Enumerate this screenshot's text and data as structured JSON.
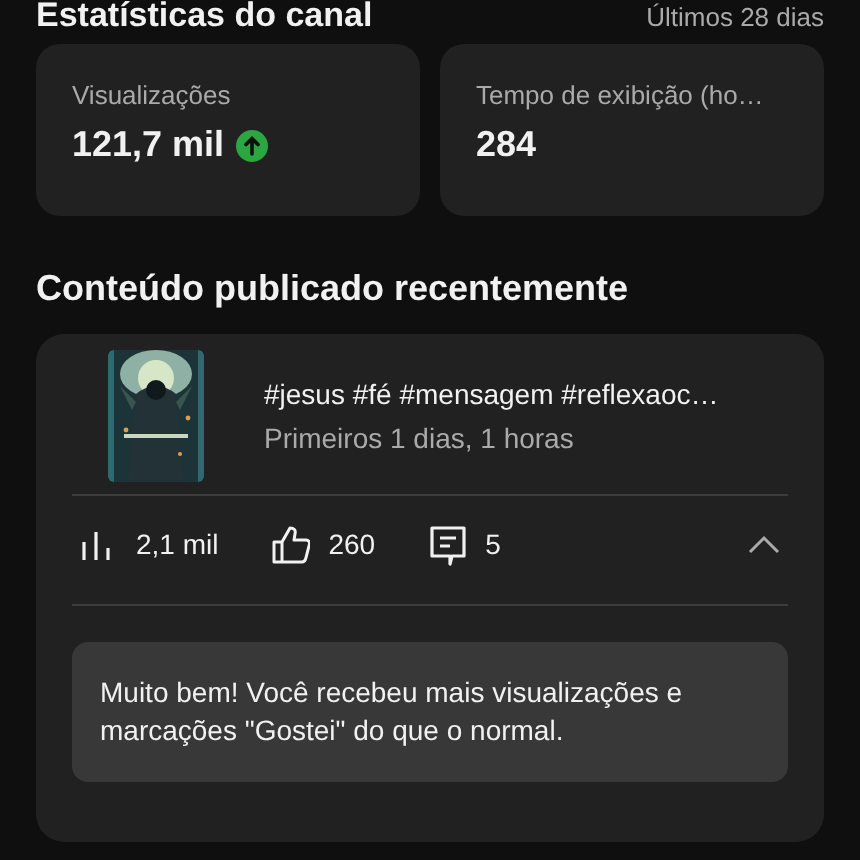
{
  "header": {
    "title": "Estatísticas do canal",
    "period": "Últimos 28 dias"
  },
  "stats": [
    {
      "label": "Visualizações",
      "value": "121,7 mil",
      "trending_up": true
    },
    {
      "label": "Tempo de exibição (ho…",
      "value": "284",
      "trending_up": false
    }
  ],
  "recent": {
    "heading": "Conteúdo publicado recentemente",
    "video": {
      "title": "#jesus #fé #mensagem #reflexaoc…",
      "subtitle": "Primeiros 1 dias, 1 horas",
      "metrics": [
        {
          "kind": "views",
          "value": "2,1 mil"
        },
        {
          "kind": "likes",
          "value": "260"
        },
        {
          "kind": "comments",
          "value": "5"
        }
      ],
      "expanded": true,
      "message": "Muito bem! Você recebeu mais visualizações e marcações \"Gostei\" do que o normal."
    }
  }
}
